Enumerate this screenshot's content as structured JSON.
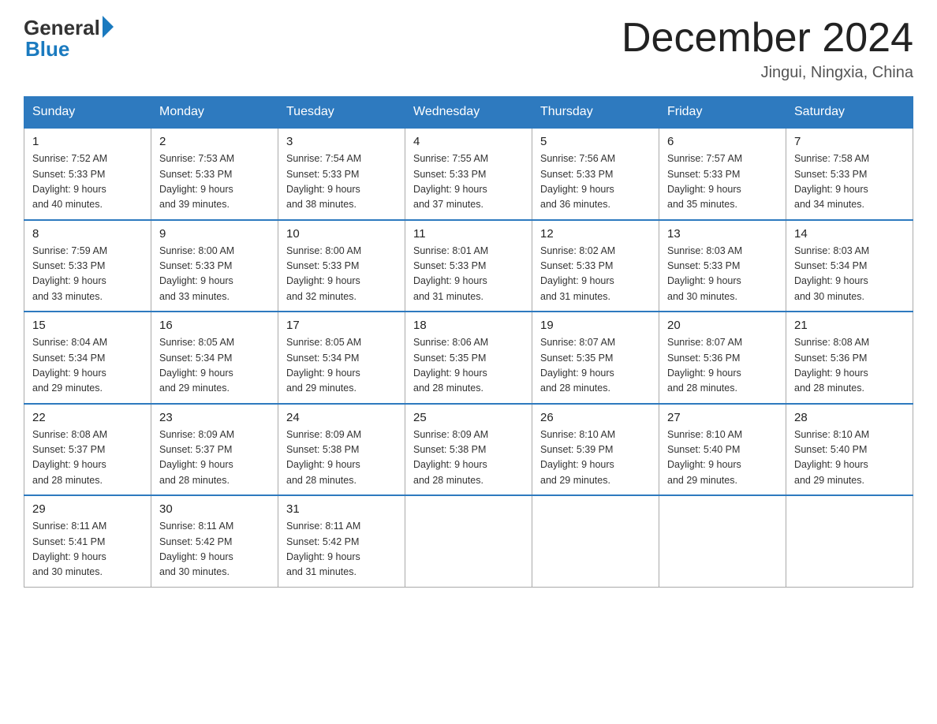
{
  "logo": {
    "general": "General",
    "blue": "Blue"
  },
  "title": "December 2024",
  "subtitle": "Jingui, Ningxia, China",
  "days_header": [
    "Sunday",
    "Monday",
    "Tuesday",
    "Wednesday",
    "Thursday",
    "Friday",
    "Saturday"
  ],
  "weeks": [
    [
      {
        "day": "1",
        "sunrise": "7:52 AM",
        "sunset": "5:33 PM",
        "daylight": "9 hours and 40 minutes."
      },
      {
        "day": "2",
        "sunrise": "7:53 AM",
        "sunset": "5:33 PM",
        "daylight": "9 hours and 39 minutes."
      },
      {
        "day": "3",
        "sunrise": "7:54 AM",
        "sunset": "5:33 PM",
        "daylight": "9 hours and 38 minutes."
      },
      {
        "day": "4",
        "sunrise": "7:55 AM",
        "sunset": "5:33 PM",
        "daylight": "9 hours and 37 minutes."
      },
      {
        "day": "5",
        "sunrise": "7:56 AM",
        "sunset": "5:33 PM",
        "daylight": "9 hours and 36 minutes."
      },
      {
        "day": "6",
        "sunrise": "7:57 AM",
        "sunset": "5:33 PM",
        "daylight": "9 hours and 35 minutes."
      },
      {
        "day": "7",
        "sunrise": "7:58 AM",
        "sunset": "5:33 PM",
        "daylight": "9 hours and 34 minutes."
      }
    ],
    [
      {
        "day": "8",
        "sunrise": "7:59 AM",
        "sunset": "5:33 PM",
        "daylight": "9 hours and 33 minutes."
      },
      {
        "day": "9",
        "sunrise": "8:00 AM",
        "sunset": "5:33 PM",
        "daylight": "9 hours and 33 minutes."
      },
      {
        "day": "10",
        "sunrise": "8:00 AM",
        "sunset": "5:33 PM",
        "daylight": "9 hours and 32 minutes."
      },
      {
        "day": "11",
        "sunrise": "8:01 AM",
        "sunset": "5:33 PM",
        "daylight": "9 hours and 31 minutes."
      },
      {
        "day": "12",
        "sunrise": "8:02 AM",
        "sunset": "5:33 PM",
        "daylight": "9 hours and 31 minutes."
      },
      {
        "day": "13",
        "sunrise": "8:03 AM",
        "sunset": "5:33 PM",
        "daylight": "9 hours and 30 minutes."
      },
      {
        "day": "14",
        "sunrise": "8:03 AM",
        "sunset": "5:34 PM",
        "daylight": "9 hours and 30 minutes."
      }
    ],
    [
      {
        "day": "15",
        "sunrise": "8:04 AM",
        "sunset": "5:34 PM",
        "daylight": "9 hours and 29 minutes."
      },
      {
        "day": "16",
        "sunrise": "8:05 AM",
        "sunset": "5:34 PM",
        "daylight": "9 hours and 29 minutes."
      },
      {
        "day": "17",
        "sunrise": "8:05 AM",
        "sunset": "5:34 PM",
        "daylight": "9 hours and 29 minutes."
      },
      {
        "day": "18",
        "sunrise": "8:06 AM",
        "sunset": "5:35 PM",
        "daylight": "9 hours and 28 minutes."
      },
      {
        "day": "19",
        "sunrise": "8:07 AM",
        "sunset": "5:35 PM",
        "daylight": "9 hours and 28 minutes."
      },
      {
        "day": "20",
        "sunrise": "8:07 AM",
        "sunset": "5:36 PM",
        "daylight": "9 hours and 28 minutes."
      },
      {
        "day": "21",
        "sunrise": "8:08 AM",
        "sunset": "5:36 PM",
        "daylight": "9 hours and 28 minutes."
      }
    ],
    [
      {
        "day": "22",
        "sunrise": "8:08 AM",
        "sunset": "5:37 PM",
        "daylight": "9 hours and 28 minutes."
      },
      {
        "day": "23",
        "sunrise": "8:09 AM",
        "sunset": "5:37 PM",
        "daylight": "9 hours and 28 minutes."
      },
      {
        "day": "24",
        "sunrise": "8:09 AM",
        "sunset": "5:38 PM",
        "daylight": "9 hours and 28 minutes."
      },
      {
        "day": "25",
        "sunrise": "8:09 AM",
        "sunset": "5:38 PM",
        "daylight": "9 hours and 28 minutes."
      },
      {
        "day": "26",
        "sunrise": "8:10 AM",
        "sunset": "5:39 PM",
        "daylight": "9 hours and 29 minutes."
      },
      {
        "day": "27",
        "sunrise": "8:10 AM",
        "sunset": "5:40 PM",
        "daylight": "9 hours and 29 minutes."
      },
      {
        "day": "28",
        "sunrise": "8:10 AM",
        "sunset": "5:40 PM",
        "daylight": "9 hours and 29 minutes."
      }
    ],
    [
      {
        "day": "29",
        "sunrise": "8:11 AM",
        "sunset": "5:41 PM",
        "daylight": "9 hours and 30 minutes."
      },
      {
        "day": "30",
        "sunrise": "8:11 AM",
        "sunset": "5:42 PM",
        "daylight": "9 hours and 30 minutes."
      },
      {
        "day": "31",
        "sunrise": "8:11 AM",
        "sunset": "5:42 PM",
        "daylight": "9 hours and 31 minutes."
      },
      null,
      null,
      null,
      null
    ]
  ]
}
